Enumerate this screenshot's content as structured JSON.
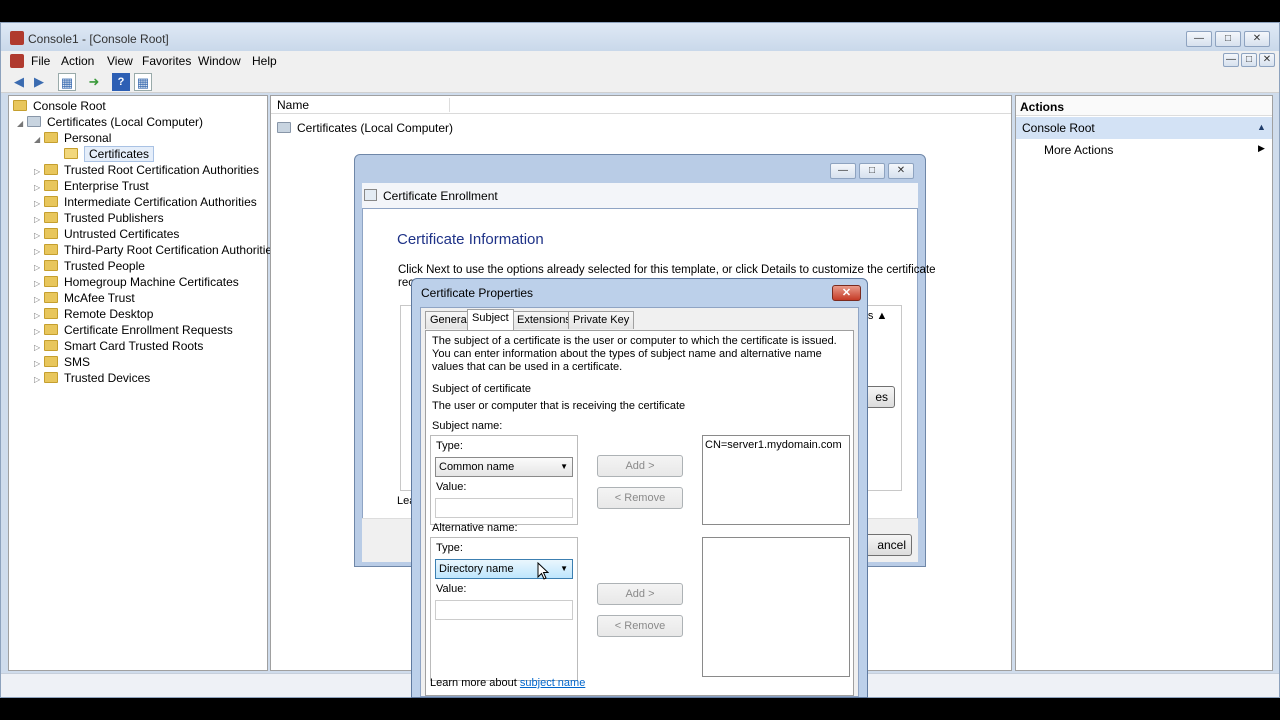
{
  "window": {
    "title": "Console1 - [Console Root]",
    "menu": [
      "File",
      "Action",
      "View",
      "Favorites",
      "Window",
      "Help"
    ]
  },
  "tree": {
    "root": "Console Root",
    "computer": "Certificates (Local Computer)",
    "personal": "Personal",
    "certificates": "Certificates",
    "items": [
      "Trusted Root Certification Authorities",
      "Enterprise Trust",
      "Intermediate Certification Authorities",
      "Trusted Publishers",
      "Untrusted Certificates",
      "Third-Party Root Certification Authorities",
      "Trusted People",
      "Homegroup Machine Certificates",
      "McAfee Trust",
      "Remote Desktop",
      "Certificate Enrollment Requests",
      "Smart Card Trusted Roots",
      "SMS",
      "Trusted Devices"
    ]
  },
  "list": {
    "column_name": "Name",
    "row": "Certificates (Local Computer)"
  },
  "actions": {
    "header": "Actions",
    "section": "Console Root",
    "more": "More Actions"
  },
  "wizard": {
    "title": "Certificate Enrollment",
    "heading": "Certificate Information",
    "desc": "Click Next to use the options already selected for this template, or click Details to customize the certificate",
    "desc_cut": "rec",
    "details_cut": "ils",
    "properties_cut": "es",
    "learn_cut": "Lea",
    "cancel_cut": "ancel"
  },
  "props": {
    "title": "Certificate Properties",
    "tabs": [
      "General",
      "Subject",
      "Extensions",
      "Private Key"
    ],
    "intro": "The subject of a certificate is the user or computer to which the certificate is issued. You can enter information about the types of subject name and alternative name values that can be used in a certificate.",
    "subject_heading": "Subject of certificate",
    "subject_sub": "The user or computer that is receiving the certificate",
    "subject_name_label": "Subject name:",
    "type_label": "Type:",
    "value_label": "Value:",
    "subject_type": "Common name",
    "subject_value": "CN=server1.mydomain.com",
    "alt_name_label": "Alternative name:",
    "alt_type": "Directory name",
    "add_btn": "Add >",
    "remove_btn": "< Remove",
    "learn_prefix": "Learn more about ",
    "learn_link": "subject name"
  }
}
